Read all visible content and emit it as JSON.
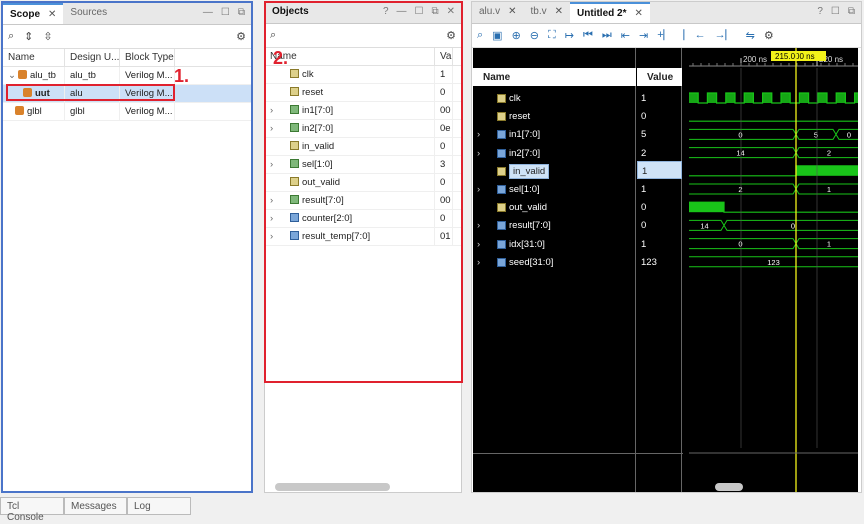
{
  "scope_panel": {
    "tabs": [
      {
        "label": "Scope",
        "active": true
      },
      {
        "label": "Sources",
        "active": false
      }
    ],
    "columns": [
      "Name",
      "Design U...",
      "Block Type"
    ],
    "rows": [
      {
        "name": "alu_tb",
        "design_unit": "alu_tb",
        "block_type": "Verilog M..."
      },
      {
        "name": "uut",
        "design_unit": "alu",
        "block_type": "Verilog M..."
      },
      {
        "name": "glbl",
        "design_unit": "glbl",
        "block_type": "Verilog M..."
      }
    ],
    "annotation": "1."
  },
  "objects_panel": {
    "title": "Objects",
    "columns": [
      "Name",
      "Va"
    ],
    "rows": [
      {
        "name": "clk",
        "value": "1",
        "icon": "signal-icon"
      },
      {
        "name": "reset",
        "value": "0",
        "icon": "signal-icon"
      },
      {
        "name": "in1[7:0]",
        "value": "00",
        "icon": "bus-icon"
      },
      {
        "name": "in2[7:0]",
        "value": "0e",
        "icon": "bus-icon"
      },
      {
        "name": "in_valid",
        "value": "0",
        "icon": "signal-icon"
      },
      {
        "name": "sel[1:0]",
        "value": "3",
        "icon": "bus-icon"
      },
      {
        "name": "out_valid",
        "value": "0",
        "icon": "signal-icon"
      },
      {
        "name": "result[7:0]",
        "value": "00",
        "icon": "bus-icon"
      },
      {
        "name": "counter[2:0]",
        "value": "0",
        "icon": "counter-icon"
      },
      {
        "name": "result_temp[7:0]",
        "value": "01",
        "icon": "counter-icon"
      }
    ],
    "annotation": "2."
  },
  "wave_panel": {
    "tabs": [
      {
        "label": "alu.v",
        "active": false
      },
      {
        "label": "tb.v",
        "active": false
      },
      {
        "label": "Untitled 2*",
        "active": true
      }
    ],
    "name_header": "Name",
    "value_header": "Value",
    "cursor_time": "215.000",
    "cursor_unit": "ns",
    "ruler": [
      "200",
      "ns",
      "220",
      "ns"
    ],
    "signals": [
      {
        "name": "clk",
        "value": "1"
      },
      {
        "name": "reset",
        "value": "0"
      },
      {
        "name": "in1[7:0]",
        "value": "5"
      },
      {
        "name": "in2[7:0]",
        "value": "2"
      },
      {
        "name": "in_valid",
        "value": "1"
      },
      {
        "name": "sel[1:0]",
        "value": "1"
      },
      {
        "name": "out_valid",
        "value": "0"
      },
      {
        "name": "result[7:0]",
        "value": "0"
      },
      {
        "name": "idx[31:0]",
        "value": "1"
      },
      {
        "name": "seed[31:0]",
        "value": "123"
      }
    ],
    "bus_labels": {
      "in1": [
        "0",
        "5",
        "0"
      ],
      "in2": [
        "14",
        "2"
      ],
      "sel": [
        "2",
        "1"
      ],
      "result": [
        "14",
        "0"
      ],
      "idx": [
        "0",
        "1"
      ],
      "seed": [
        "123"
      ]
    }
  },
  "bottom_tabs": [
    "Tcl Console",
    "Messages",
    "Log"
  ]
}
